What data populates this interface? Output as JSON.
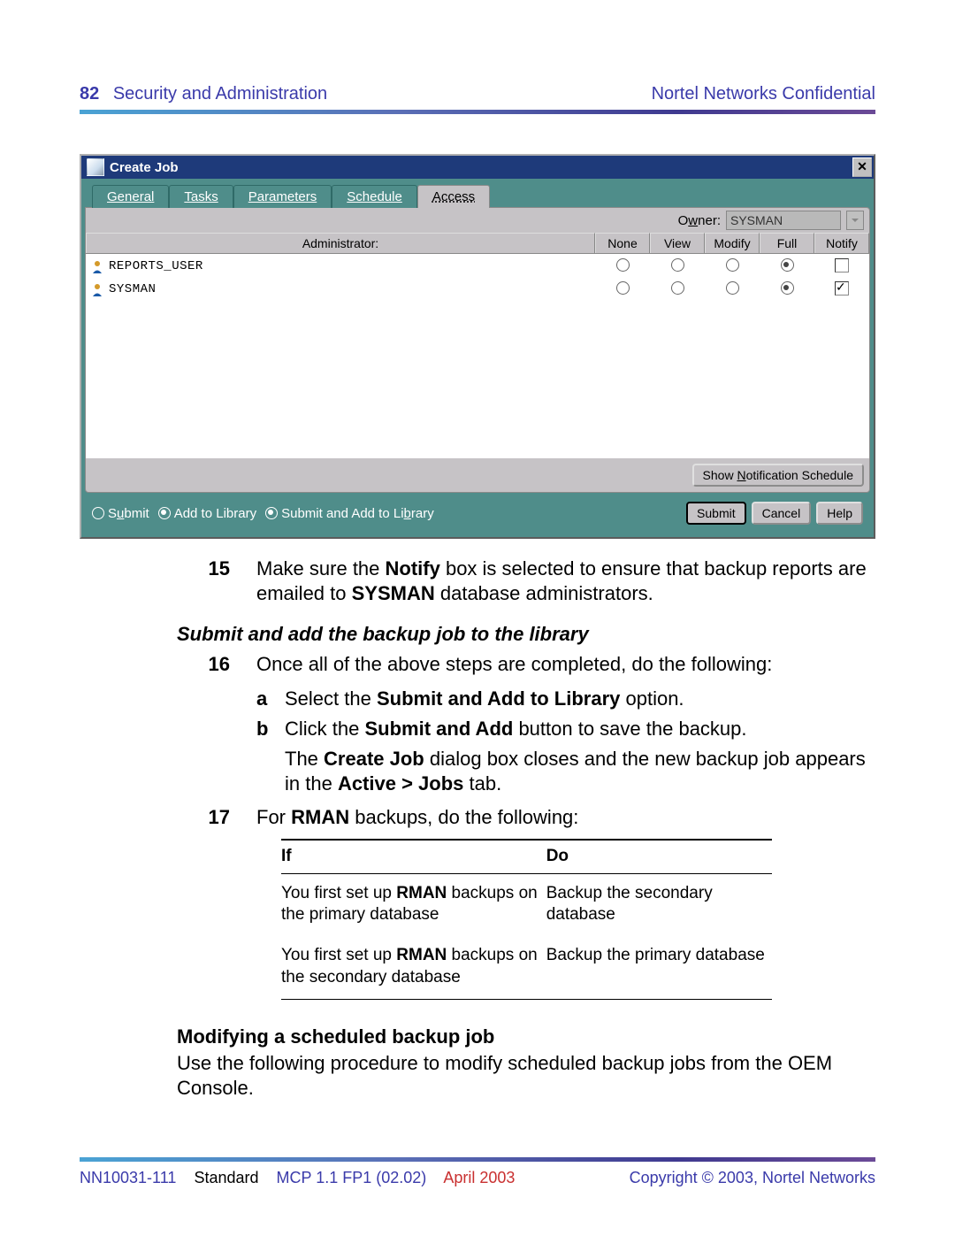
{
  "header": {
    "page_number": "82",
    "section_title": "Security and Administration",
    "confidential": "Nortel Networks Confidential"
  },
  "window": {
    "title": "Create Job",
    "close_glyph": "✕",
    "tabs": {
      "general": "General",
      "tasks": "Tasks",
      "parameters": "Parameters",
      "schedule": "Schedule",
      "access": "Access"
    },
    "owner_label": "Owner:",
    "owner_value": "SYSMAN",
    "columns": {
      "admin": "Administrator:",
      "none": "None",
      "view": "View",
      "modify": "Modify",
      "full": "Full",
      "notify": "Notify"
    },
    "rows": [
      {
        "admin": "REPORTS_USER",
        "selected": "full",
        "notify": false
      },
      {
        "admin": "SYSMAN",
        "selected": "full",
        "notify": true
      }
    ],
    "show_notification_btn": "Show Notification Schedule",
    "radio_options": {
      "submit": "Submit",
      "addlib": "Add to Library",
      "both": "Submit and Add to Library"
    },
    "buttons": {
      "submit": "Submit",
      "cancel": "Cancel",
      "help": "Help"
    }
  },
  "doc": {
    "step15_num": "15",
    "step15_a": "Make sure the ",
    "step15_b1": "Notify",
    "step15_c": " box is selected to ensure that backup reports are emailed to ",
    "step15_b2": "SYSMAN",
    "step15_d": " database administrators.",
    "subheading1": "Submit and add the backup job to the library",
    "step16_num": "16",
    "step16_txt": "Once all of the above steps are completed, do the following:",
    "step16a_let": "a",
    "step16a_a": "Select the ",
    "step16a_b": "Submit and Add to Library",
    "step16a_c": " option.",
    "step16b_let": "b",
    "step16b_a": "Click the ",
    "step16b_b": "Submit and Add",
    "step16b_c": " button to save the backup.",
    "step16b_p_a": "The ",
    "step16b_p_b1": "Create Job",
    "step16b_p_c": " dialog box closes and the new backup job appears in the ",
    "step16b_p_b2": "Active > Jobs",
    "step16b_p_d": " tab.",
    "step17_num": "17",
    "step17_a": "For ",
    "step17_b": "RMAN",
    "step17_c": " backups, do the following:",
    "ifdo": {
      "if_h": "If",
      "do_h": "Do",
      "r1_if_a": "You first set up ",
      "r1_if_b": "RMAN",
      "r1_if_c": " backups on the primary database",
      "r1_do": "Backup the secondary database",
      "r2_if_a": "You first set up ",
      "r2_if_b": "RMAN",
      "r2_if_c": " backups on the secondary database",
      "r2_do": "Backup the primary database"
    },
    "heading2": "Modifying a scheduled backup job",
    "para2": "Use the following procedure to modify scheduled backup jobs from the OEM Console."
  },
  "footer": {
    "code": "NN10031-111",
    "standard": "Standard",
    "version": "MCP 1.1 FP1 (02.02)",
    "date": "April 2003",
    "copyright": "Copyright © 2003, Nortel Networks"
  }
}
